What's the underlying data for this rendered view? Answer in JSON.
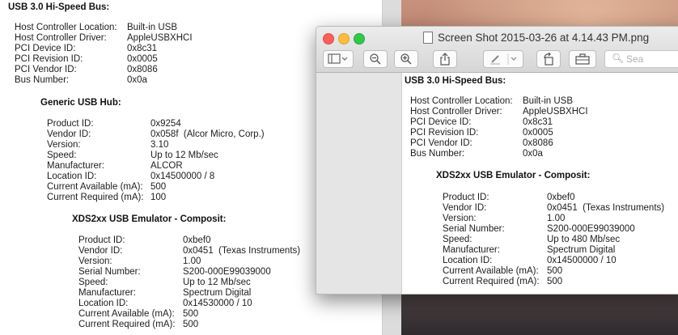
{
  "background_doc": {
    "bus_title": "USB 3.0 Hi-Speed Bus:",
    "bus_fields": [
      {
        "label": "Host Controller Location:",
        "value": "Built-in USB"
      },
      {
        "label": "Host Controller Driver:",
        "value": "AppleUSBXHCI"
      },
      {
        "label": "PCI Device ID:",
        "value": "0x8c31"
      },
      {
        "label": "PCI Revision ID:",
        "value": "0x0005"
      },
      {
        "label": "PCI Vendor ID:",
        "value": "0x8086"
      },
      {
        "label": "Bus Number:",
        "value": "0x0a"
      }
    ],
    "hub_title": "Generic USB Hub:",
    "hub_fields": [
      {
        "label": "Product ID:",
        "value": "0x9254"
      },
      {
        "label": "Vendor ID:",
        "value": "0x058f  (Alcor Micro, Corp.)"
      },
      {
        "label": "Version:",
        "value": "3.10"
      },
      {
        "label": "Speed:",
        "value": "Up to 12 Mb/sec"
      },
      {
        "label": "Manufacturer:",
        "value": "ALCOR"
      },
      {
        "label": "Location ID:",
        "value": "0x14500000 / 8"
      },
      {
        "label": "Current Available (mA):",
        "value": "500"
      },
      {
        "label": "Current Required (mA):",
        "value": "100"
      }
    ],
    "device_title": "XDS2xx USB Emulator - Composit:",
    "device_fields": [
      {
        "label": "Product ID:",
        "value": "0xbef0"
      },
      {
        "label": "Vendor ID:",
        "value": "0x0451  (Texas Instruments)"
      },
      {
        "label": "Version:",
        "value": "1.00"
      },
      {
        "label": "Serial Number:",
        "value": "S200-000E99039000"
      },
      {
        "label": "Speed:",
        "value": "Up to 12 Mb/sec"
      },
      {
        "label": "Manufacturer:",
        "value": "Spectrum Digital"
      },
      {
        "label": "Location ID:",
        "value": "0x14530000 / 10"
      },
      {
        "label": "Current Available (mA):",
        "value": "500"
      },
      {
        "label": "Current Required (mA):",
        "value": "500"
      }
    ]
  },
  "preview": {
    "title": "Screen Shot 2015-03-26 at 4.14.43 PM.png",
    "search_placeholder": "Sea",
    "toolbar_icons": [
      "sidebar-icon",
      "zoom-out-icon",
      "zoom-in-icon",
      "share-icon",
      "markup-icon",
      "rotate-icon",
      "toolbox-icon"
    ],
    "bus_title": "USB 3.0 Hi-Speed Bus:",
    "bus_fields": [
      {
        "label": "Host Controller Location:",
        "value": "Built-in USB"
      },
      {
        "label": "Host Controller Driver:",
        "value": "AppleUSBXHCI"
      },
      {
        "label": "PCI Device ID:",
        "value": "0x8c31"
      },
      {
        "label": "PCI Revision ID:",
        "value": "0x0005"
      },
      {
        "label": "PCI Vendor ID:",
        "value": "0x8086"
      },
      {
        "label": "Bus Number:",
        "value": "0x0a"
      }
    ],
    "device_title": "XDS2xx USB Emulator - Composit:",
    "device_fields": [
      {
        "label": "Product ID:",
        "value": "0xbef0"
      },
      {
        "label": "Vendor ID:",
        "value": "0x0451  (Texas Instruments)"
      },
      {
        "label": "Version:",
        "value": "1.00"
      },
      {
        "label": "Serial Number:",
        "value": "S200-000E99039000"
      },
      {
        "label": "Speed:",
        "value": "Up to 480 Mb/sec"
      },
      {
        "label": "Manufacturer:",
        "value": "Spectrum Digital"
      },
      {
        "label": "Location ID:",
        "value": "0x14500000 / 10"
      },
      {
        "label": "Current Available (mA):",
        "value": "500"
      },
      {
        "label": "Current Required (mA):",
        "value": "500"
      }
    ]
  }
}
